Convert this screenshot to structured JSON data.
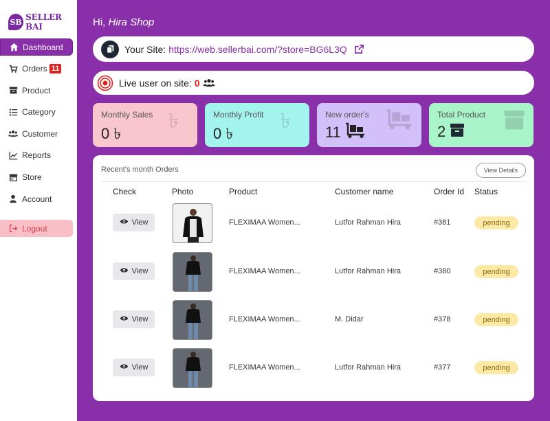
{
  "brand": {
    "mark": "SB",
    "name": "SELLER BAI"
  },
  "sidebar": {
    "items": [
      {
        "label": "Dashboard",
        "icon": "home-icon",
        "active": true
      },
      {
        "label": "Orders",
        "icon": "cart-icon",
        "badge": "11"
      },
      {
        "label": "Product",
        "icon": "box-icon"
      },
      {
        "label": "Category",
        "icon": "list-icon"
      },
      {
        "label": "Customer",
        "icon": "users-icon"
      },
      {
        "label": "Reports",
        "icon": "chart-icon"
      },
      {
        "label": "Store",
        "icon": "store-icon"
      },
      {
        "label": "Account",
        "icon": "user-icon"
      }
    ],
    "logout": "Logout"
  },
  "header": {
    "greeting": "Hi,",
    "shop_name": "Hira Shop"
  },
  "site": {
    "label": "Your Site:",
    "url": "https://web.sellerbai.com/?store=BG6L3Q"
  },
  "live": {
    "label": "Live user on site:",
    "count": "0"
  },
  "cards": [
    {
      "label": "Monthly Sales",
      "value": "0 ৳",
      "icon": "taka-icon",
      "color": "#f8c6cc"
    },
    {
      "label": "Monthly Profit",
      "value": "0 ৳",
      "icon": "taka-icon",
      "color": "#a3f3ee"
    },
    {
      "label": "New order's",
      "value": "11",
      "icon": "dolly-icon",
      "color": "#d2c0fa"
    },
    {
      "label": "Total Product",
      "value": "2",
      "icon": "box-icon",
      "color": "#a9f4c9"
    }
  ],
  "orders": {
    "title": "Recent's month Orders",
    "view_details": "View Details",
    "columns": [
      "Check",
      "Photo",
      "Product",
      "Customer name",
      "Order Id",
      "Status"
    ],
    "view_label": "View",
    "rows": [
      {
        "product": "FLEXIMAA Women...",
        "customer": "Lutfor Rahman Hira",
        "order_id": "#381",
        "status": "pending"
      },
      {
        "product": "FLEXIMAA Women...",
        "customer": "Lutfor Rahman Hira",
        "order_id": "#380",
        "status": "pending"
      },
      {
        "product": "FLEXIMAA Women...",
        "customer": "M. Didar",
        "order_id": "#378",
        "status": "pending"
      },
      {
        "product": "FLEXIMAA Women...",
        "customer": "Lutfor Rahman Hira",
        "order_id": "#377",
        "status": "pending"
      }
    ]
  },
  "colors": {
    "primary": "#8a2faa",
    "badge": "#e0201f",
    "pending_bg": "#fde9a6"
  }
}
